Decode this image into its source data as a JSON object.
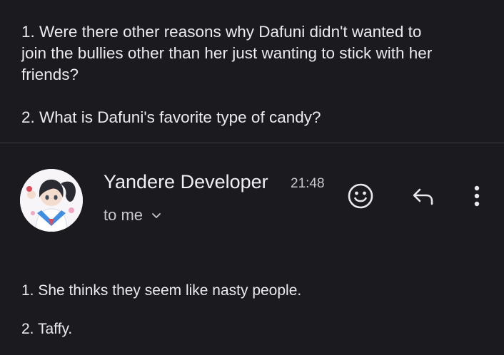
{
  "quoted_message": {
    "line1": "1. Were there other reasons why Dafuni didn't wanted to",
    "line2": "join the bullies other than her just wanting to stick with her",
    "line3": "friends?",
    "line4": "2. What is Dafuni's favorite type of candy?"
  },
  "email": {
    "sender_name": "Yandere Developer",
    "time": "21:48",
    "recipient": "to me",
    "body_line1": "1. She thinks they seem like nasty people.",
    "body_line2": "2. Taffy."
  },
  "actions": {
    "emoji_icon": "smiley-face-icon",
    "reply_icon": "reply-arrow-icon",
    "more_icon": "more-vertical-icon"
  },
  "colors": {
    "background": "#1b1a1e",
    "text": "#ebeaee",
    "muted_text": "#c9c8cd",
    "divider": "#3d3c41"
  }
}
